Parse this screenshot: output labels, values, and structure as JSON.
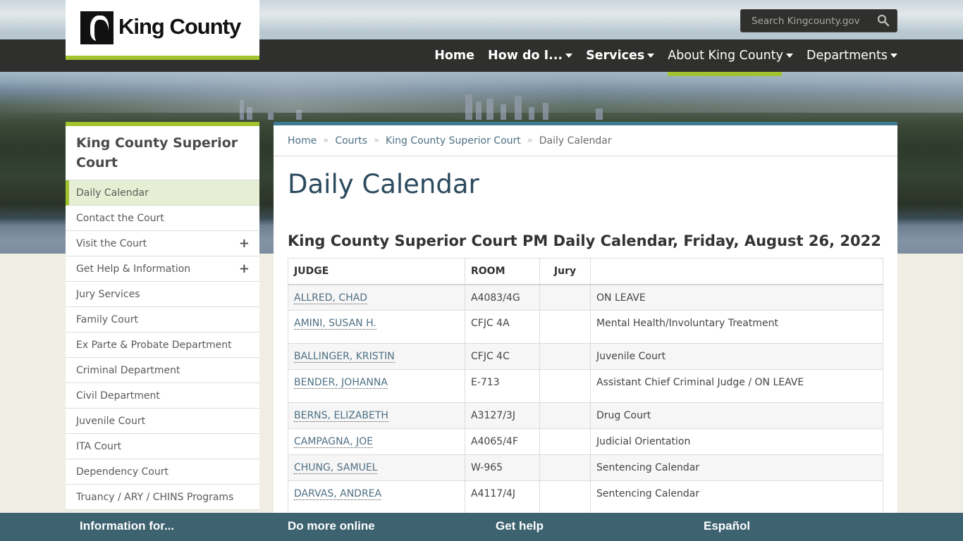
{
  "header": {
    "logo_text": "King County",
    "search_placeholder": "Search Kingcounty.gov",
    "nav": [
      {
        "label": "Home",
        "has_dropdown": false
      },
      {
        "label": "How do I...",
        "has_dropdown": true
      },
      {
        "label": "Services",
        "has_dropdown": true
      },
      {
        "label": "About King County",
        "has_dropdown": true,
        "active": true
      },
      {
        "label": "Departments",
        "has_dropdown": true
      }
    ]
  },
  "sidebar": {
    "title": "King County Superior Court",
    "items": [
      {
        "label": "Daily Calendar",
        "active": true
      },
      {
        "label": "Contact the Court"
      },
      {
        "label": "Visit the Court",
        "expandable": true
      },
      {
        "label": "Get Help & Information",
        "expandable": true
      },
      {
        "label": "Jury Services"
      },
      {
        "label": "Family Court"
      },
      {
        "label": "Ex Parte & Probate Department"
      },
      {
        "label": "Criminal Department"
      },
      {
        "label": "Civil Department"
      },
      {
        "label": "Juvenile Court"
      },
      {
        "label": "ITA Court"
      },
      {
        "label": "Dependency Court"
      },
      {
        "label": "Truancy / ARY / CHINS Programs"
      }
    ]
  },
  "breadcrumb": [
    {
      "label": "Home"
    },
    {
      "label": "Courts"
    },
    {
      "label": "King County Superior Court"
    },
    {
      "label": "Daily Calendar",
      "current": true
    }
  ],
  "main": {
    "title": "Daily Calendar",
    "subtitle": "King County Superior Court PM Daily Calendar, Friday, August 26, 2022",
    "table": {
      "headers": [
        "JUDGE",
        "ROOM",
        "Jury",
        ""
      ],
      "rows": [
        {
          "judge": "ALLRED, CHAD",
          "room": "A4083/4G",
          "jury": "",
          "note": "ON LEAVE"
        },
        {
          "judge": "AMINI, SUSAN H.",
          "room": "CFJC 4A",
          "jury": "",
          "note": "Mental Health/Involuntary Treatment"
        },
        {
          "judge": "BALLINGER, KRISTIN",
          "room": "CFJC 4C",
          "jury": "",
          "note": "Juvenile Court"
        },
        {
          "judge": "BENDER, JOHANNA",
          "room": "E-713",
          "jury": "",
          "note": "Assistant Chief Criminal Judge / ON LEAVE"
        },
        {
          "judge": "BERNS, ELIZABETH",
          "room": "A3127/3J",
          "jury": "",
          "note": "Drug Court"
        },
        {
          "judge": "CAMPAGNA, JOE",
          "room": "A4065/4F",
          "jury": "",
          "note": "Judicial Orientation"
        },
        {
          "judge": "CHUNG, SAMUEL",
          "room": "W-965",
          "jury": "",
          "note": "Sentencing Calendar"
        },
        {
          "judge": "DARVAS, ANDREA",
          "room": "A4117/4J",
          "jury": "",
          "note": "Sentencing Calendar"
        }
      ]
    }
  },
  "footer": {
    "links": [
      "Information for...",
      "Do more online",
      "Get help",
      "Español"
    ]
  },
  "colors": {
    "accent_green": "#a0c32e",
    "nav_dark": "#2f2f2d",
    "content_top_border": "#3d7a93",
    "footer_bg": "#3d6270",
    "link": "#4e6f84",
    "title": "#2b4a5e"
  }
}
